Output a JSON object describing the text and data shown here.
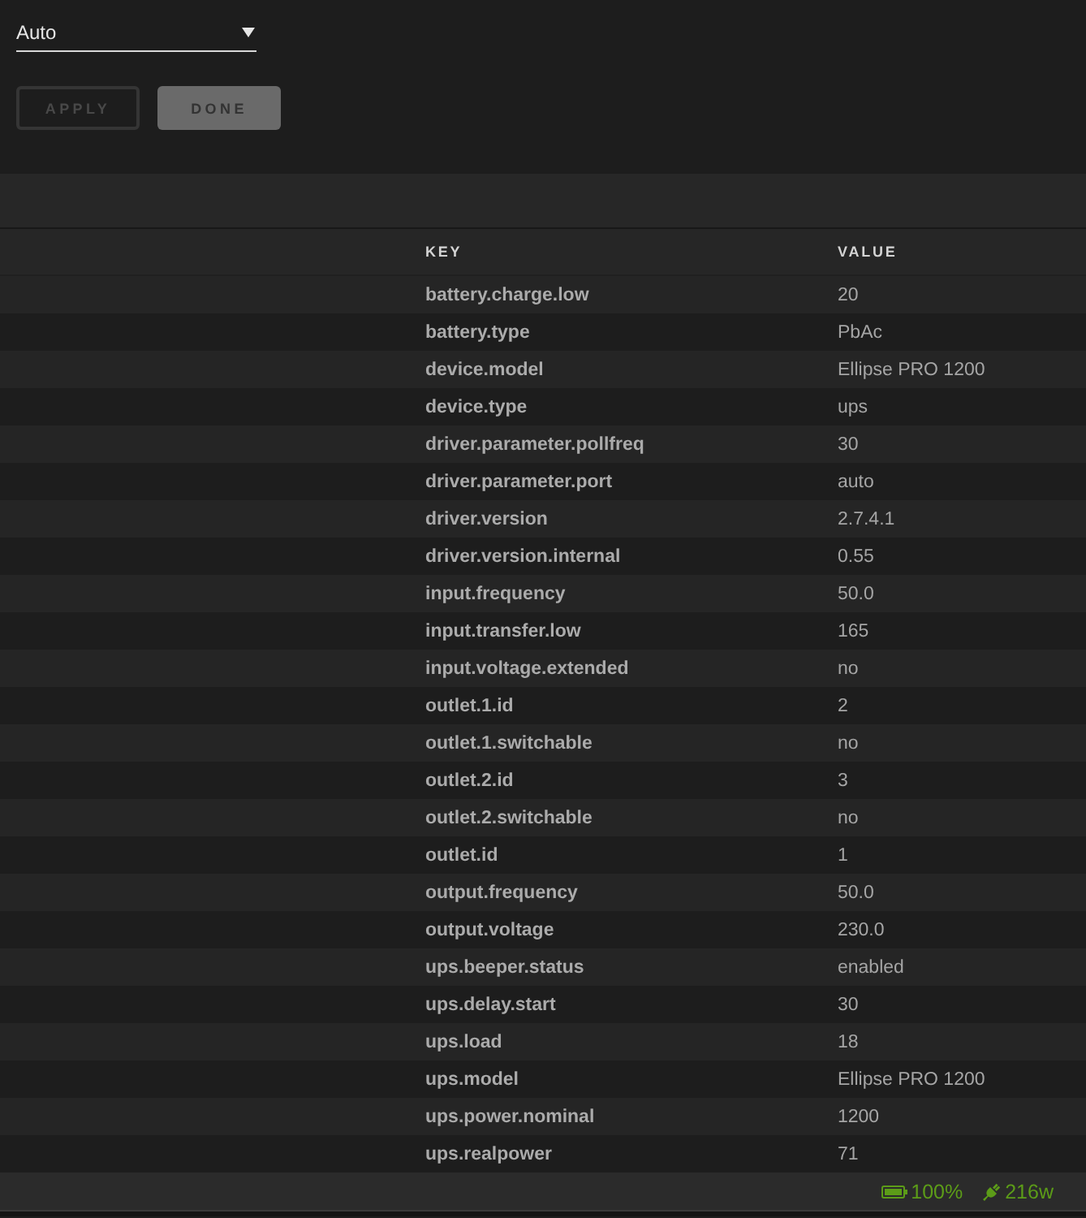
{
  "mode_select": {
    "value": "Auto"
  },
  "buttons": [
    {
      "label": "APPLY",
      "kind": "outline"
    },
    {
      "label": "DONE",
      "kind": "filled"
    }
  ],
  "table": {
    "columns": [
      "KEY",
      "VALUE"
    ],
    "rows": [
      {
        "key": "battery.charge.low",
        "value": "20"
      },
      {
        "key": "battery.type",
        "value": "PbAc"
      },
      {
        "key": "device.model",
        "value": "Ellipse PRO 1200"
      },
      {
        "key": "device.type",
        "value": "ups"
      },
      {
        "key": "driver.parameter.pollfreq",
        "value": "30"
      },
      {
        "key": "driver.parameter.port",
        "value": "auto"
      },
      {
        "key": "driver.version",
        "value": "2.7.4.1"
      },
      {
        "key": "driver.version.internal",
        "value": "0.55"
      },
      {
        "key": "input.frequency",
        "value": "50.0"
      },
      {
        "key": "input.transfer.low",
        "value": "165"
      },
      {
        "key": "input.voltage.extended",
        "value": "no"
      },
      {
        "key": "outlet.1.id",
        "value": "2"
      },
      {
        "key": "outlet.1.switchable",
        "value": "no"
      },
      {
        "key": "outlet.2.id",
        "value": "3"
      },
      {
        "key": "outlet.2.switchable",
        "value": "no"
      },
      {
        "key": "outlet.id",
        "value": "1"
      },
      {
        "key": "output.frequency",
        "value": "50.0"
      },
      {
        "key": "output.voltage",
        "value": "230.0"
      },
      {
        "key": "ups.beeper.status",
        "value": "enabled"
      },
      {
        "key": "ups.delay.start",
        "value": "30"
      },
      {
        "key": "ups.load",
        "value": "18"
      },
      {
        "key": "ups.model",
        "value": "Ellipse PRO 1200"
      },
      {
        "key": "ups.power.nominal",
        "value": "1200"
      },
      {
        "key": "ups.realpower",
        "value": "71"
      }
    ]
  },
  "status_bar": {
    "battery": "100%",
    "power": "216w"
  }
}
